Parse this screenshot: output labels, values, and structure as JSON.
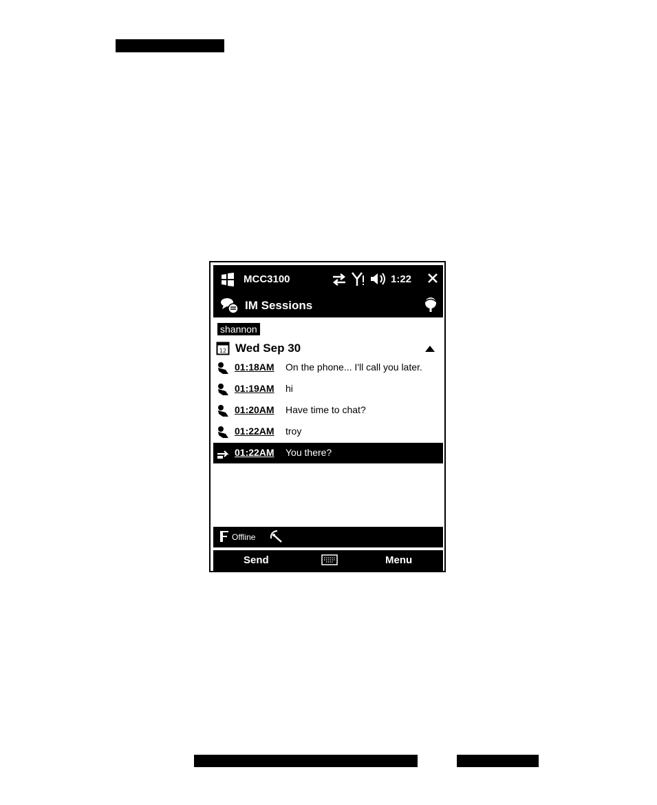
{
  "status_bar": {
    "title": "MCC3100",
    "time": "1:22",
    "icons": [
      "start-icon",
      "sync-arrows-icon",
      "signal-icon",
      "speaker-icon",
      "close-icon"
    ]
  },
  "title_bar": {
    "title": "IM Sessions",
    "icons": [
      "im-chat-icon",
      "presence-icon"
    ]
  },
  "conversation": {
    "contact": "shannon",
    "date": "Wed Sep 30",
    "messages": [
      {
        "time": "01:18AM",
        "text": "On the phone... I'll call you later.",
        "selected": false
      },
      {
        "time": "01:19AM",
        "text": "hi",
        "selected": false
      },
      {
        "time": "01:20AM",
        "text": "Have time to chat?",
        "selected": false
      },
      {
        "time": "01:22AM",
        "text": "troy",
        "selected": false
      },
      {
        "time": "01:22AM",
        "text": "You there?",
        "selected": true
      }
    ]
  },
  "presence_bar": {
    "status": "Offline"
  },
  "softkeys": {
    "left": "Send",
    "right": "Menu",
    "center_icon": "keyboard-icon"
  }
}
